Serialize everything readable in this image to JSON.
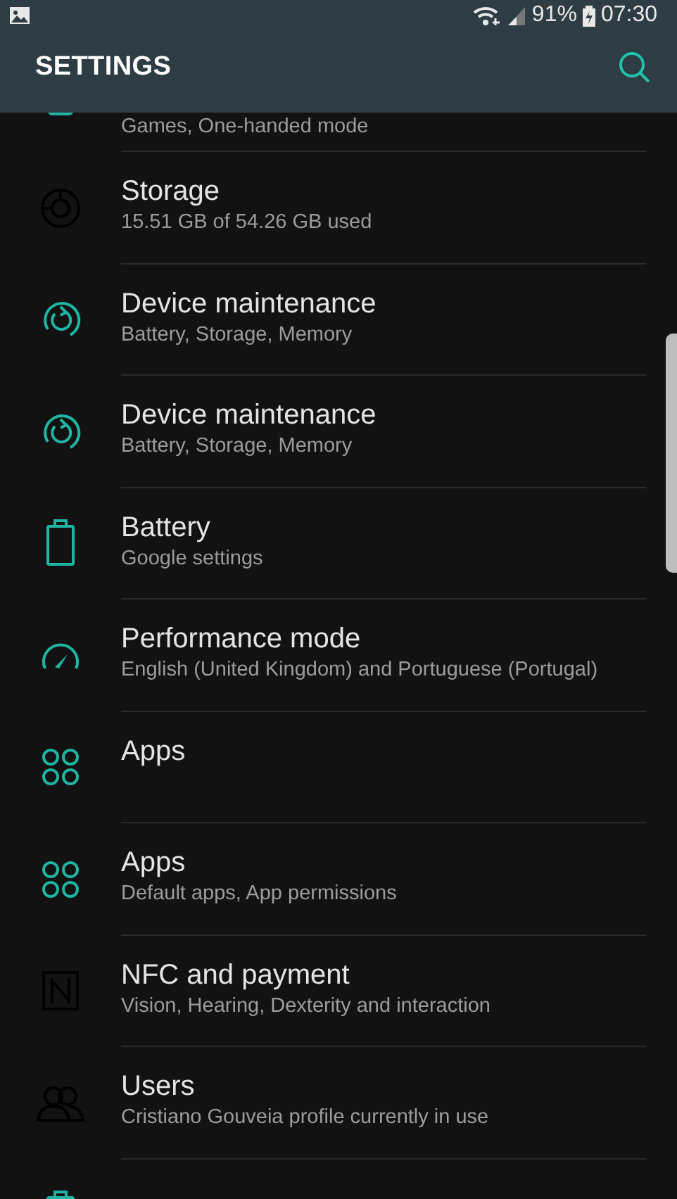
{
  "status_bar": {
    "battery_text": "91%",
    "time": "07:30"
  },
  "app_bar": {
    "title": "SETTINGS"
  },
  "partial_top": {
    "subtitle": "Games, One-handed mode",
    "kind": "teal",
    "color": "#1fb5a3"
  },
  "items": [
    {
      "title": "Storage",
      "subtitle": "15.51 GB of 54.26 GB used",
      "kind": "storage",
      "color": "#000000"
    },
    {
      "title": "Device maintenance",
      "subtitle": "Battery, Storage, Memory",
      "kind": "maintenance",
      "color": "#1fb5a3"
    },
    {
      "title": "Device maintenance",
      "subtitle": "Battery, Storage, Memory",
      "kind": "maintenance",
      "color": "#1fb5a3"
    },
    {
      "title": "Battery",
      "subtitle": "Google settings",
      "kind": "battery",
      "color": "#1fb5a3"
    },
    {
      "title": "Performance mode",
      "subtitle": "English (United Kingdom) and Portuguese (Portugal)",
      "kind": "gauge",
      "color": "#1fb5a3"
    },
    {
      "title": "Apps",
      "kind": "apps",
      "color": "#1fb5a3"
    },
    {
      "title": "Apps",
      "subtitle": "Default apps, App permissions",
      "kind": "apps",
      "color": "#1fb5a3"
    },
    {
      "title": "NFC and payment",
      "subtitle": "Vision, Hearing, Dexterity and interaction",
      "kind": "nfc",
      "color": "#000000"
    },
    {
      "title": "Users",
      "subtitle": "Cristiano Gouveia profile currently in use",
      "kind": "users",
      "color": "#000000"
    },
    {
      "kind": "battery",
      "color": "#1fb5a3"
    }
  ]
}
